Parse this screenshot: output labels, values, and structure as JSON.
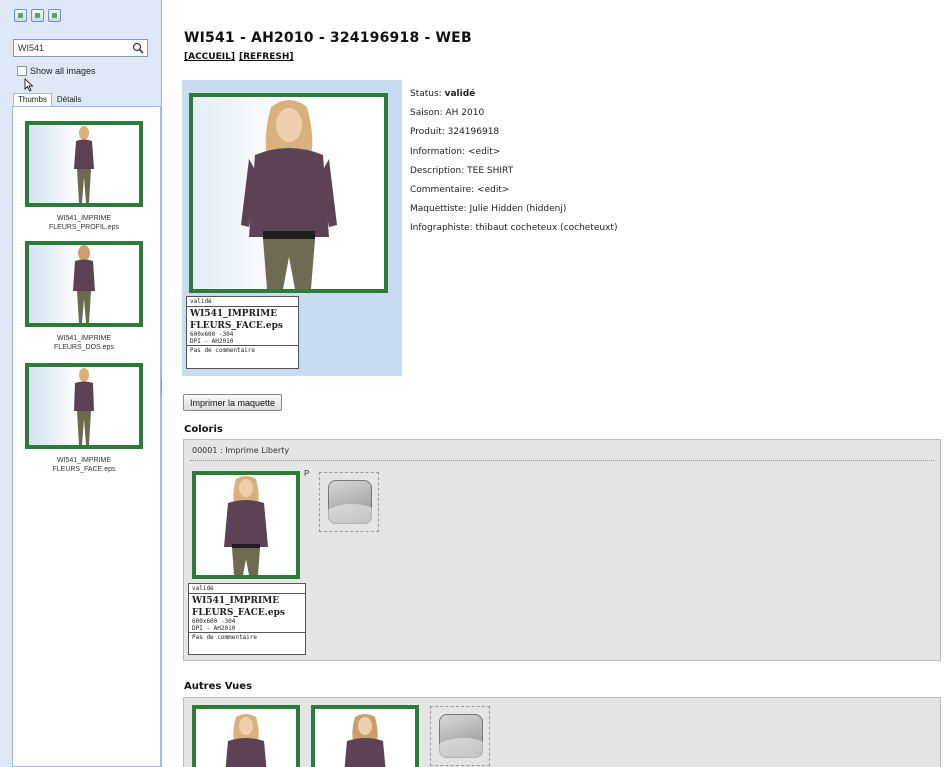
{
  "sidebar": {
    "search_value": "WI541",
    "show_all_label": "Show all images",
    "tabs": [
      "Thumbs",
      "Détails"
    ],
    "thumbs": [
      {
        "caption_line1": "WI541_IMPRIME",
        "caption_line2": "FLEURS_PROFIL.eps"
      },
      {
        "caption_line1": "WI541_IMPRIME",
        "caption_line2": "FLEURS_DOS.eps"
      },
      {
        "caption_line1": "WI541_IMPRIME",
        "caption_line2": "FLEURS_FACE.eps"
      }
    ]
  },
  "main": {
    "title": "WI541 - AH2010 - 324196918 - WEB",
    "links": [
      "[ACCUEIL]",
      "[REFRESH]"
    ],
    "image_card": {
      "status": "validé",
      "filename_line1": "WI541_IMPRIME",
      "filename_line2": "FLEURS_FACE.eps",
      "meta_line1": "600x600 -304",
      "meta_line2": "DPI - AH2010",
      "comment": "Pas de commentaire"
    },
    "details": {
      "status_label": "Status:",
      "status_value": "validé",
      "saison": "Saison: AH 2010",
      "produit": "Produit: 324196918",
      "information": "Information: <edit>",
      "description": "Description: TEE SHIRT",
      "commentaire": "Commentaire: <edit>",
      "maquettiste": "Maquettiste: Julie Hidden (hiddenj)",
      "infographiste": "Infographiste: thibaut cocheteux (cocheteuxt)"
    },
    "print_button": "Imprimer la maquette",
    "coloris": {
      "title": "Coloris",
      "header": "00001 : Imprime Liberty",
      "marker": "P",
      "card": {
        "status": "validé",
        "filename_line1": "WI541_IMPRIME",
        "filename_line2": "FLEURS_FACE.eps",
        "meta_line1": "600x600 -304",
        "meta_line2": "DPI - AH2010",
        "comment": "Pas de commentaire"
      }
    },
    "autres_vues": {
      "title": "Autres Vues"
    }
  },
  "colors": {
    "frame_green": "#2d7a3a",
    "sidebar_bg": "#dfe8f6",
    "card_blue": "#c7dcef",
    "panel_grey": "#e5e5e5"
  }
}
